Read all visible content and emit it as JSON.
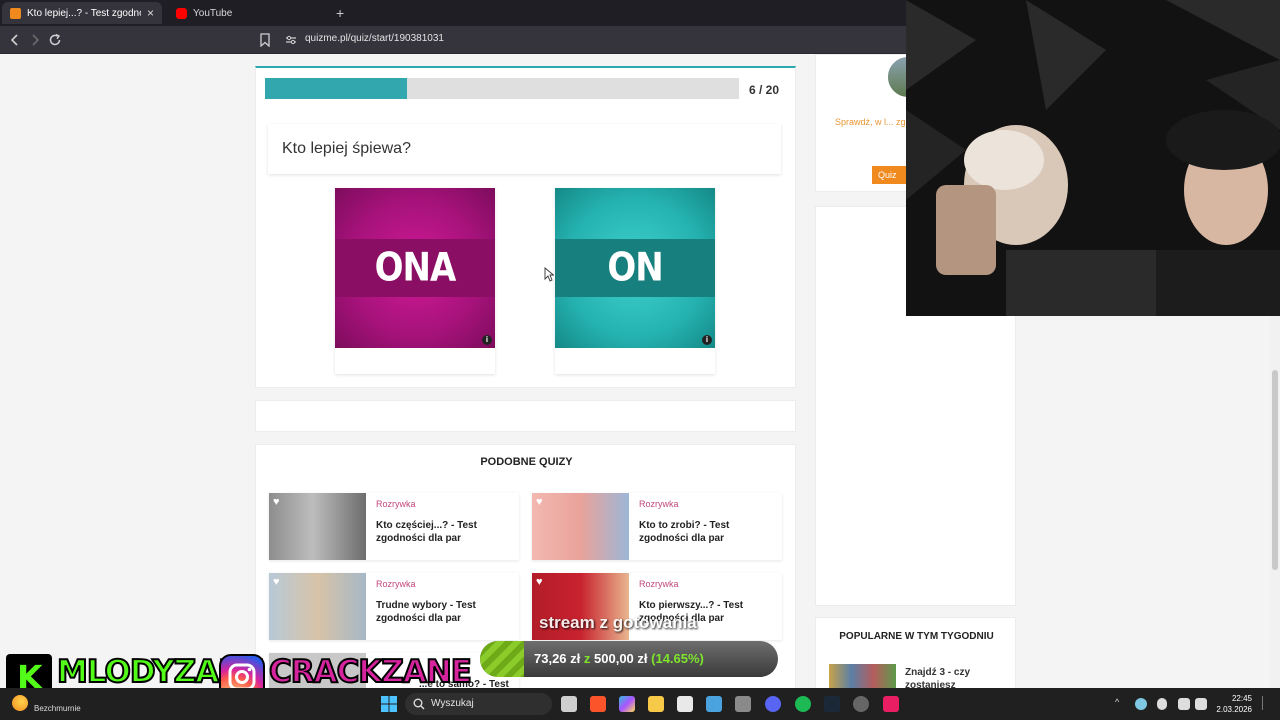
{
  "browser": {
    "tabs": [
      {
        "label": "Kto lepiej...? - Test zgodności dla",
        "active": true
      },
      {
        "label": "YouTube",
        "active": false
      }
    ],
    "new_tab": "+",
    "tab_close": "×",
    "url": "quizme.pl/quiz/start/190381031"
  },
  "quiz": {
    "progress_text": "6 / 20",
    "progress_fraction": 0.3,
    "question": "Kto lepiej śpiewa?",
    "answers": [
      {
        "label": "ONA",
        "color": "#b0157f"
      },
      {
        "label": "ON",
        "color": "#2bb8b6"
      }
    ],
    "info_glyph": "i"
  },
  "similar": {
    "title": "PODOBNE QUIZY",
    "items": [
      {
        "category": "Rozrywka",
        "title": "Kto częściej...? - Test zgodności dla par"
      },
      {
        "category": "Rozrywka",
        "title": "Kto to zrobi? - Test zgodności dla par"
      },
      {
        "category": "Rozrywka",
        "title": "Trudne wybory - Test zgodności dla par"
      },
      {
        "category": "Rozrywka",
        "title": "Kto pierwszy...? - Test zgodności dla par"
      },
      {
        "category": "",
        "title": "...e to samo? - Test"
      }
    ]
  },
  "sidebar": {
    "promo_text": "Sprawdź, w l... zga...",
    "button_label": "Quiz",
    "popular_title": "POPULARNE W TYM TYGODNIU",
    "popular_item": "Znajdź 3 - czy zostaniesz"
  },
  "overlay": {
    "goal_current": "73,26 zł",
    "goal_of": "z",
    "goal_total": "500,00 zł",
    "goal_percent": "(14.65%)",
    "goal_fraction": 0.1465,
    "stream_text": "stream z gotowania",
    "kick_handle": "MLODYZANE",
    "kick_letter": "K",
    "ig_handle": "CRACKZANE"
  },
  "taskbar": {
    "weather": "Bezchmurnie",
    "search_placeholder": "Wyszukaj",
    "time": "22:45",
    "date": "2.03.2026"
  }
}
